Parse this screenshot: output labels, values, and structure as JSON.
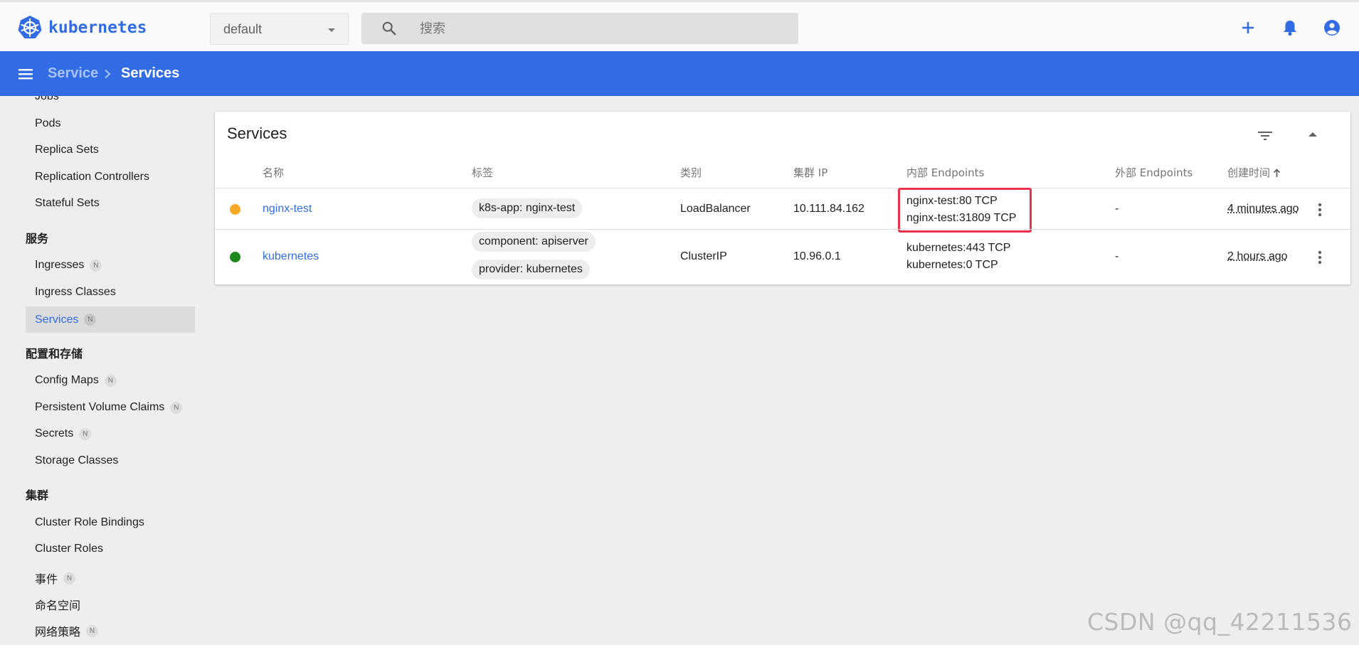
{
  "topbar": {
    "logo_text": "kubernetes",
    "namespace": "default",
    "search_placeholder": "搜索"
  },
  "breadcrumb": {
    "parent": "Service",
    "current": "Services"
  },
  "sidebar": {
    "items_top": [
      {
        "label": "Jobs"
      },
      {
        "label": "Pods"
      },
      {
        "label": "Replica Sets"
      },
      {
        "label": "Replication Controllers"
      },
      {
        "label": "Stateful Sets"
      }
    ],
    "group_service": "服务",
    "items_service": [
      {
        "label": "Ingresses",
        "badge": "N"
      },
      {
        "label": "Ingress Classes"
      },
      {
        "label": "Services",
        "badge": "N",
        "active": true
      }
    ],
    "group_config": "配置和存储",
    "items_config": [
      {
        "label": "Config Maps",
        "badge": "N"
      },
      {
        "label": "Persistent Volume Claims",
        "badge": "N"
      },
      {
        "label": "Secrets",
        "badge": "N"
      },
      {
        "label": "Storage Classes"
      }
    ],
    "group_cluster": "集群",
    "items_cluster": [
      {
        "label": "Cluster Role Bindings"
      },
      {
        "label": "Cluster Roles"
      },
      {
        "label": "事件",
        "badge": "N"
      },
      {
        "label": "命名空间"
      },
      {
        "label": "网络策略",
        "badge": "N"
      }
    ]
  },
  "card": {
    "title": "Services",
    "columns": [
      "名称",
      "标签",
      "类别",
      "集群 IP",
      "内部 Endpoints",
      "外部 Endpoints",
      "创建时间"
    ],
    "rows": [
      {
        "status_color": "#f9a825",
        "name": "nginx-test",
        "labels": [
          "k8s-app: nginx-test"
        ],
        "type": "LoadBalancer",
        "cluster_ip": "10.111.84.162",
        "internal_endpoints": [
          "nginx-test:80 TCP",
          "nginx-test:31809 TCP"
        ],
        "external_endpoints": "-",
        "created": "4 minutes ago"
      },
      {
        "status_color": "#1b8a1b",
        "name": "kubernetes",
        "labels": [
          "component: apiserver",
          "provider: kubernetes"
        ],
        "type": "ClusterIP",
        "cluster_ip": "10.96.0.1",
        "internal_endpoints": [
          "kubernetes:443 TCP",
          "kubernetes:0 TCP"
        ],
        "external_endpoints": "-",
        "created": "2 hours ago"
      }
    ]
  },
  "colors": {
    "primary": "#326ce5",
    "highlight_border": "#e8334a"
  },
  "watermark": "CSDN @qq_42211536"
}
